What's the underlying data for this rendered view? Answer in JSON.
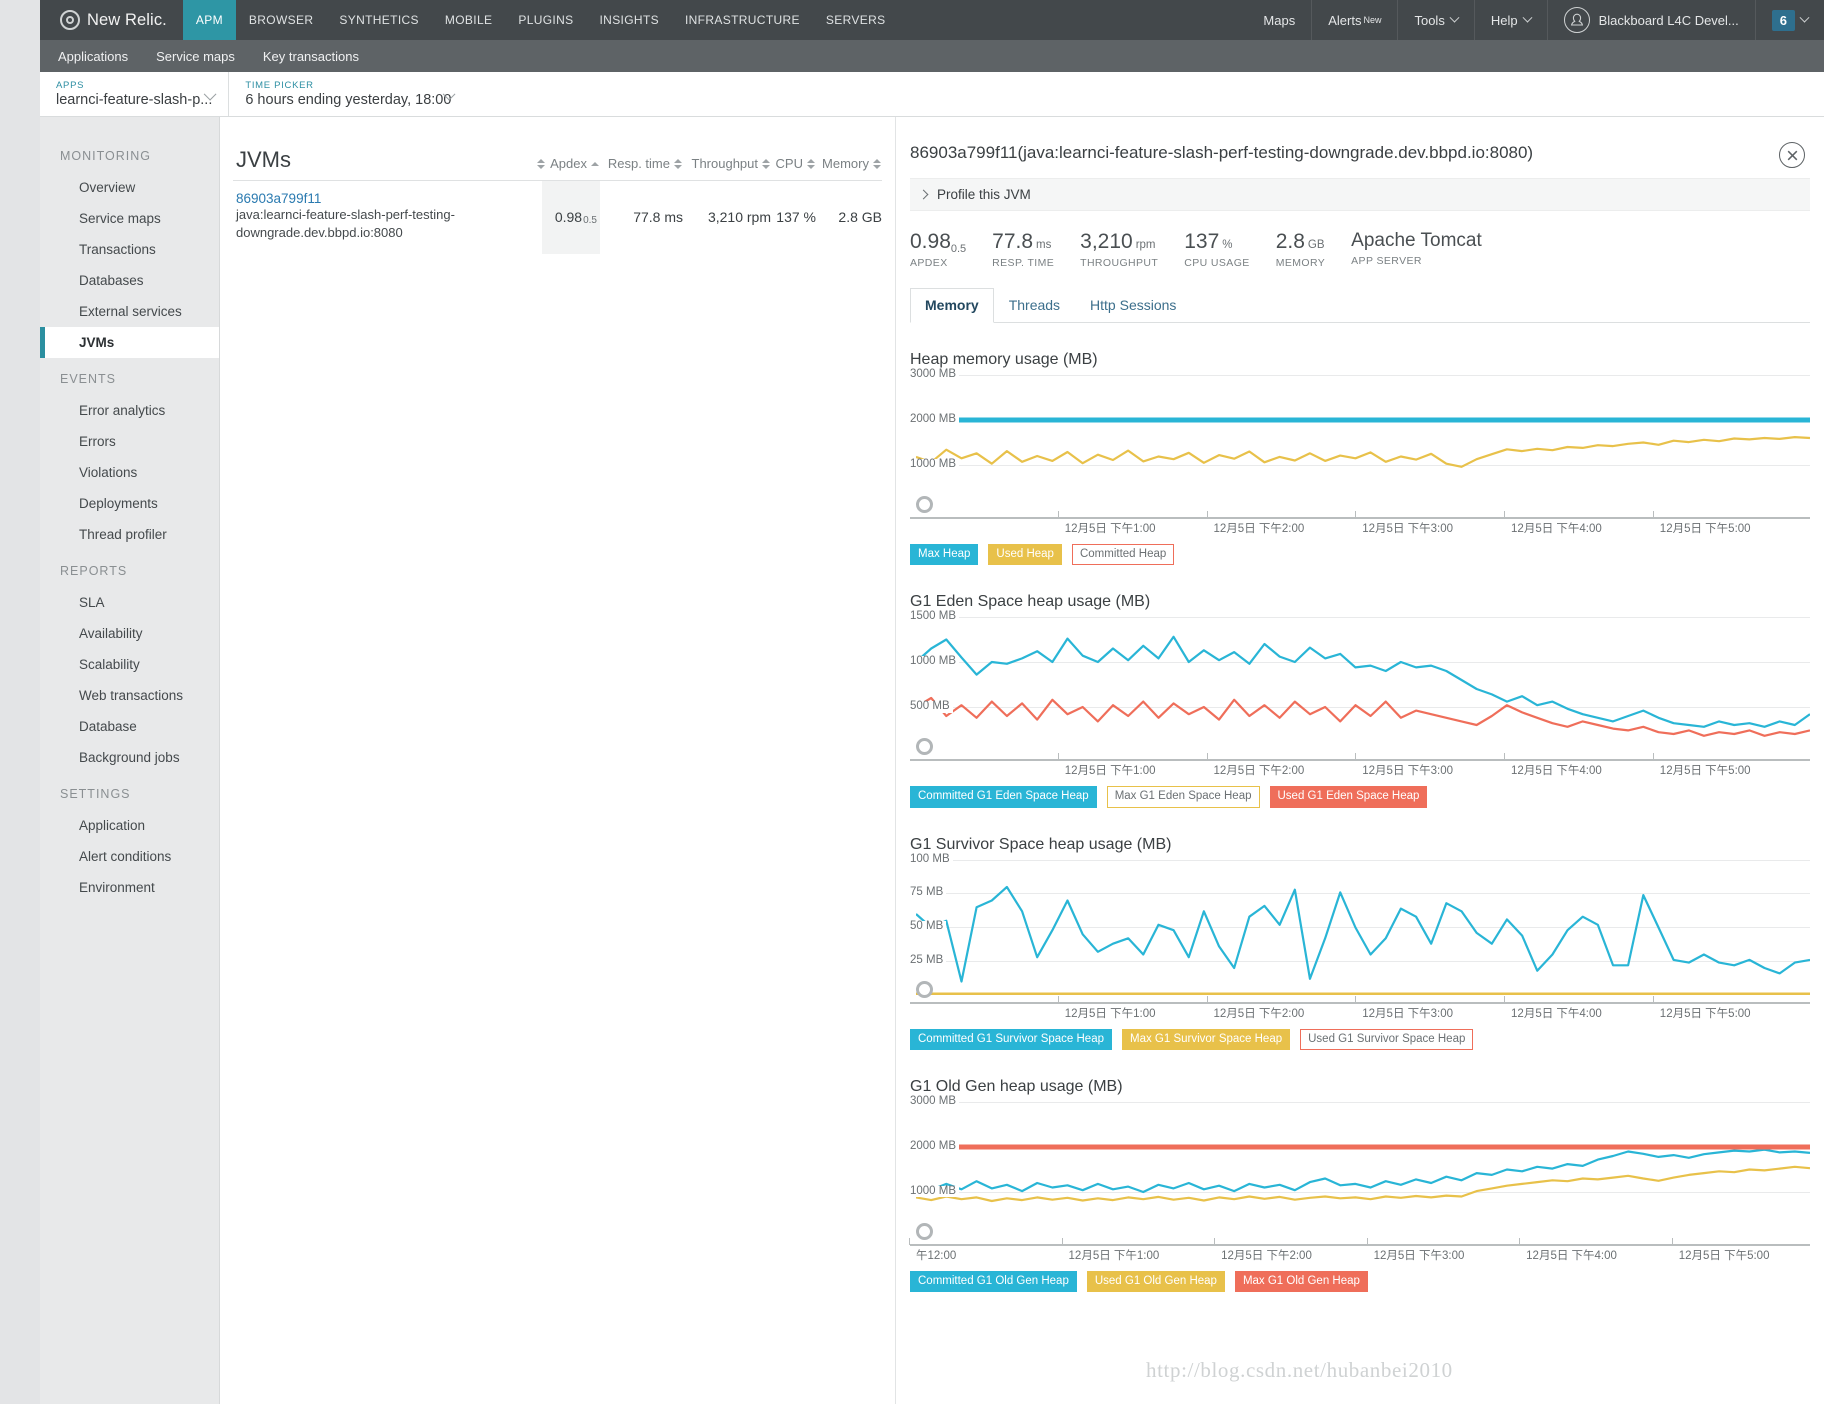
{
  "topnav": {
    "brand": "New Relic.",
    "items": [
      {
        "label": "APM",
        "active": true
      },
      {
        "label": "BROWSER",
        "active": false
      },
      {
        "label": "SYNTHETICS",
        "active": false
      },
      {
        "label": "MOBILE",
        "active": false
      },
      {
        "label": "PLUGINS",
        "active": false
      },
      {
        "label": "INSIGHTS",
        "active": false
      },
      {
        "label": "INFRASTRUCTURE",
        "active": false
      },
      {
        "label": "SERVERS",
        "active": false
      }
    ],
    "maps": "Maps",
    "alerts": "Alerts",
    "alerts_badge": "New",
    "tools": "Tools",
    "help": "Help",
    "account": "Blackboard L4C Devel...",
    "account_count": "6"
  },
  "subnav": {
    "items": [
      "Applications",
      "Service maps",
      "Key transactions"
    ]
  },
  "pickers": {
    "apps_label": "APPS",
    "apps_value": "learnci-feature-slash-p...",
    "time_label": "TIME PICKER",
    "time_value": "6 hours ending yesterday, 18:00"
  },
  "sidebar": {
    "groups": [
      {
        "heading": "MONITORING",
        "items": [
          {
            "label": "Overview",
            "active": false
          },
          {
            "label": "Service maps",
            "active": false
          },
          {
            "label": "Transactions",
            "active": false
          },
          {
            "label": "Databases",
            "active": false
          },
          {
            "label": "External services",
            "active": false
          },
          {
            "label": "JVMs",
            "active": true
          }
        ]
      },
      {
        "heading": "EVENTS",
        "items": [
          {
            "label": "Error analytics",
            "active": false
          },
          {
            "label": "Errors",
            "active": false
          },
          {
            "label": "Violations",
            "active": false
          },
          {
            "label": "Deployments",
            "active": false
          },
          {
            "label": "Thread profiler",
            "active": false
          }
        ]
      },
      {
        "heading": "REPORTS",
        "items": [
          {
            "label": "SLA",
            "active": false
          },
          {
            "label": "Availability",
            "active": false
          },
          {
            "label": "Scalability",
            "active": false
          },
          {
            "label": "Web transactions",
            "active": false
          },
          {
            "label": "Database",
            "active": false
          },
          {
            "label": "Background jobs",
            "active": false
          }
        ]
      },
      {
        "heading": "SETTINGS",
        "items": [
          {
            "label": "Application",
            "active": false
          },
          {
            "label": "Alert conditions",
            "active": false
          },
          {
            "label": "Environment",
            "active": false
          }
        ]
      }
    ]
  },
  "list": {
    "title": "JVMs",
    "columns": [
      "Apdex",
      "Resp. time",
      "Throughput",
      "CPU",
      "Memory"
    ],
    "row": {
      "name": "86903a799f11",
      "sub": "java:learnci-feature-slash-perf-testing-downgrade.dev.bbpd.io:8080",
      "apdex": "0.98",
      "apdex_threshold": "0.5",
      "resp_time": "77.8 ms",
      "throughput": "3,210 rpm",
      "cpu": "137 %",
      "memory": "2.8 GB"
    }
  },
  "detail": {
    "title": "86903a799f11(java:learnci-feature-slash-perf-testing-downgrade.dev.bbpd.io:8080)",
    "profile_link": "Profile this JVM",
    "kpis": [
      {
        "value": "0.98",
        "sub": "0.5",
        "unit": "",
        "label": "APDEX"
      },
      {
        "value": "77.8",
        "sub": "",
        "unit": "ms",
        "label": "RESP. TIME"
      },
      {
        "value": "3,210",
        "sub": "",
        "unit": "rpm",
        "label": "THROUGHPUT"
      },
      {
        "value": "137",
        "sub": "",
        "unit": "%",
        "label": "CPU USAGE"
      },
      {
        "value": "2.8",
        "sub": "",
        "unit": "GB",
        "label": "MEMORY"
      },
      {
        "value": "Apache Tomcat",
        "sub": "",
        "unit": "",
        "label": "APP SERVER"
      }
    ],
    "tabs": [
      {
        "label": "Memory",
        "active": true
      },
      {
        "label": "Threads",
        "active": false
      },
      {
        "label": "Http Sessions",
        "active": false
      }
    ]
  },
  "colors": {
    "cyan": "#29b5d6",
    "yellow": "#e8c14a",
    "red": "#ef6e5a",
    "accent": "#2e96a5",
    "link": "#2a7ab0"
  },
  "watermark": "http://blog.csdn.net/hubanbei2010",
  "chart_data": [
    {
      "type": "line",
      "title": "Heap memory usage (MB)",
      "ylabel": "MB",
      "ylim": [
        0,
        3000
      ],
      "yticks": [
        3000,
        2000,
        1000
      ],
      "ytick_labels": [
        "3000 MB",
        "2000 MB",
        "1000 MB"
      ],
      "grid": true,
      "legend_position": "bottom",
      "xticks": [
        "12月5日 下午1:00",
        "12月5日 下午2:00",
        "12月5日 下午3:00",
        "12月5日 下午4:00",
        "12月5日 下午5:00"
      ],
      "series": [
        {
          "name": "Max Heap",
          "color": "#29b5d6",
          "style": "filled",
          "constant": 2000,
          "values": [
            2000,
            2000,
            2000,
            2000,
            2000,
            2000,
            2000,
            2000,
            2000,
            2000,
            2000,
            2000,
            2000,
            2000,
            2000,
            2000,
            2000,
            2000,
            2000,
            2000
          ]
        },
        {
          "name": "Used Heap",
          "color": "#e8c14a",
          "style": "filled",
          "values": [
            1180,
            1060,
            1340,
            1150,
            1260,
            1030,
            1310,
            1070,
            1200,
            1090,
            1290,
            1040,
            1230,
            1110,
            1320,
            1080,
            1190,
            1130,
            1270,
            1050,
            1220,
            1140,
            1300,
            1060,
            1180,
            1100,
            1260,
            1090,
            1210,
            1150,
            1280,
            1070,
            1190,
            1120,
            1250,
            1030,
            960,
            1130,
            1240,
            1350,
            1310,
            1360,
            1330,
            1400,
            1380,
            1440,
            1420,
            1470,
            1500,
            1450,
            1540,
            1510,
            1560,
            1530,
            1590,
            1570,
            1600,
            1580,
            1620,
            1600
          ]
        },
        {
          "name": "Committed Heap",
          "color": "#ef6e5a",
          "style": "hollow",
          "hidden": true,
          "values": []
        }
      ]
    },
    {
      "type": "line",
      "title": "G1 Eden Space heap usage (MB)",
      "ylabel": "MB",
      "ylim": [
        0,
        1500
      ],
      "yticks": [
        1500,
        1000,
        500
      ],
      "ytick_labels": [
        "1500 MB",
        "1000 MB",
        "500 MB"
      ],
      "grid": true,
      "legend_position": "bottom",
      "xticks": [
        "12月5日 下午1:00",
        "12月5日 下午2:00",
        "12月5日 下午3:00",
        "12月5日 下午4:00",
        "12月5日 下午5:00"
      ],
      "series": [
        {
          "name": "Committed G1 Eden Space Heap",
          "color": "#29b5d6",
          "style": "filled",
          "values": [
            1000,
            1150,
            1250,
            1050,
            860,
            1000,
            980,
            1040,
            1120,
            1000,
            1260,
            1070,
            1000,
            1150,
            1020,
            1180,
            1040,
            1280,
            1000,
            1130,
            1020,
            1110,
            980,
            1200,
            1060,
            1000,
            1160,
            1040,
            1090,
            940,
            960,
            900,
            1000,
            940,
            960,
            900,
            800,
            700,
            640,
            560,
            620,
            520,
            560,
            480,
            420,
            380,
            340,
            400,
            460,
            380,
            320,
            300,
            280,
            340,
            300,
            320,
            280,
            340,
            300,
            420
          ]
        },
        {
          "name": "Max G1 Eden Space Heap",
          "color": "#e8c14a",
          "style": "hollow",
          "hidden": true,
          "values": []
        },
        {
          "name": "Used G1 Eden Space Heap",
          "color": "#ef6e5a",
          "style": "filled",
          "values": [
            500,
            600,
            400,
            520,
            380,
            560,
            400,
            540,
            360,
            580,
            420,
            500,
            340,
            520,
            400,
            560,
            380,
            540,
            420,
            500,
            360,
            580,
            400,
            520,
            380,
            560,
            420,
            500,
            340,
            520,
            400,
            560,
            380,
            460,
            420,
            380,
            340,
            300,
            400,
            520,
            440,
            380,
            320,
            280,
            340,
            300,
            260,
            240,
            280,
            220,
            200,
            240,
            180,
            220,
            200,
            240,
            180,
            220,
            200,
            240
          ]
        }
      ]
    },
    {
      "type": "line",
      "title": "G1 Survivor Space heap usage (MB)",
      "ylabel": "MB",
      "ylim": [
        0,
        100
      ],
      "yticks": [
        100,
        75,
        50,
        25
      ],
      "ytick_labels": [
        "100 MB",
        "75 MB",
        "50 MB",
        "25 MB"
      ],
      "grid": true,
      "legend_position": "bottom",
      "xticks": [
        "12月5日 下午1:00",
        "12月5日 下午2:00",
        "12月5日 下午3:00",
        "12月5日 下午4:00",
        "12月5日 下午5:00"
      ],
      "series": [
        {
          "name": "Committed G1 Survivor Space Heap",
          "color": "#29b5d6",
          "style": "filled",
          "values": [
            60,
            50,
            55,
            10,
            65,
            70,
            80,
            62,
            28,
            48,
            70,
            45,
            32,
            38,
            42,
            30,
            52,
            48,
            28,
            62,
            36,
            20,
            58,
            66,
            52,
            78,
            12,
            42,
            76,
            50,
            30,
            42,
            64,
            58,
            38,
            68,
            62,
            46,
            38,
            56,
            44,
            18,
            30,
            48,
            58,
            52,
            22,
            22,
            74,
            50,
            26,
            24,
            30,
            24,
            22,
            26,
            20,
            16,
            24,
            26
          ]
        },
        {
          "name": "Max G1 Survivor Space Heap",
          "color": "#e8c14a",
          "style": "filled",
          "constant": 0,
          "values": []
        },
        {
          "name": "Used G1 Survivor Space Heap",
          "color": "#ef6e5a",
          "style": "hollow",
          "hidden": true,
          "values": []
        }
      ]
    },
    {
      "type": "line",
      "title": "G1 Old Gen heap usage (MB)",
      "ylabel": "MB",
      "ylim": [
        0,
        3000
      ],
      "yticks": [
        3000,
        2000,
        1000
      ],
      "ytick_labels": [
        "3000 MB",
        "2000 MB",
        "1000 MB"
      ],
      "grid": true,
      "legend_position": "bottom",
      "xticks": [
        "午12:00",
        "12月5日 下午1:00",
        "12月5日 下午2:00",
        "12月5日 下午3:00",
        "12月5日 下午4:00",
        "12月5日 下午5:00"
      ],
      "series": [
        {
          "name": "Committed G1 Old Gen Heap",
          "color": "#29b5d6",
          "style": "filled",
          "values": [
            1100,
            1050,
            1180,
            1060,
            1240,
            1080,
            1160,
            1020,
            1200,
            1100,
            1150,
            1040,
            1180,
            1060,
            1120,
            1000,
            1160,
            1080,
            1200,
            1060,
            1140,
            1020,
            1180,
            1100,
            1160,
            1040,
            1220,
            1300,
            1150,
            1180,
            1100,
            1240,
            1160,
            1280,
            1200,
            1340,
            1260,
            1420,
            1380,
            1500,
            1460,
            1560,
            1520,
            1620,
            1580,
            1720,
            1800,
            1900,
            1850,
            1780,
            1820,
            1760,
            1840,
            1880,
            1920,
            1900,
            1940,
            1880,
            1900,
            1870
          ]
        },
        {
          "name": "Used G1 Old Gen Heap",
          "color": "#e8c14a",
          "style": "filled",
          "values": [
            880,
            820,
            900,
            840,
            880,
            800,
            860,
            820,
            880,
            830,
            870,
            810,
            860,
            820,
            880,
            840,
            890,
            830,
            870,
            810,
            880,
            840,
            900,
            850,
            890,
            830,
            870,
            900,
            860,
            880,
            840,
            900,
            870,
            910,
            880,
            920,
            900,
            1020,
            1080,
            1140,
            1180,
            1220,
            1260,
            1240,
            1300,
            1280,
            1320,
            1360,
            1300,
            1250,
            1320,
            1380,
            1420,
            1460,
            1440,
            1500,
            1480,
            1520,
            1560,
            1530
          ]
        },
        {
          "name": "Max G1 Old Gen Heap",
          "color": "#ef6e5a",
          "style": "filled",
          "constant": 2000,
          "values": [
            2000,
            2000,
            2000,
            2000,
            2000,
            2000,
            2000,
            2000,
            2000,
            2000,
            2000,
            2000,
            2000,
            2000,
            2000,
            2000,
            2000,
            2000,
            2000,
            2000
          ]
        }
      ]
    }
  ]
}
